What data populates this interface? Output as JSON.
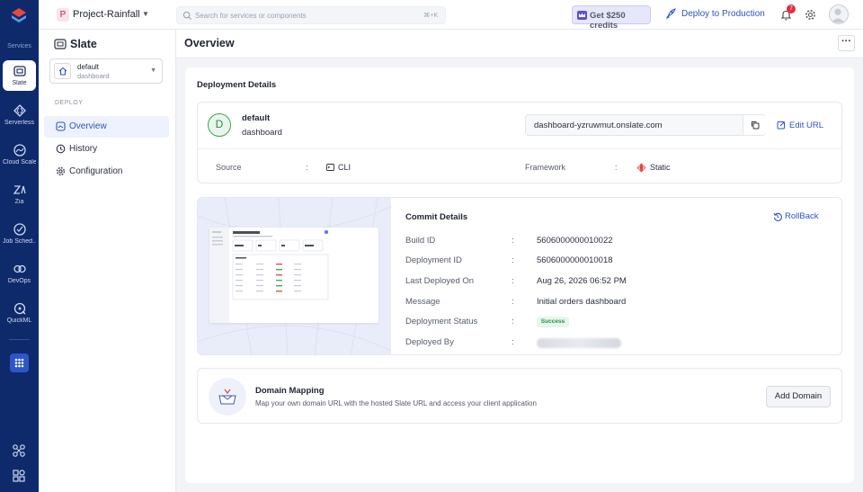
{
  "rail": {
    "section": "Services",
    "items": [
      {
        "label": "Slate",
        "icon": "slate-icon"
      },
      {
        "label": "Serverless",
        "icon": "serverless-icon"
      },
      {
        "label": "Cloud Scale",
        "icon": "cloud-scale-icon"
      },
      {
        "label": "Zia",
        "icon": "zia-icon"
      },
      {
        "label": "Job Sched...",
        "icon": "job-scheduling-icon"
      },
      {
        "label": "DevOps",
        "icon": "devops-icon"
      },
      {
        "label": "QuickML",
        "icon": "quickml-icon"
      }
    ]
  },
  "topbar": {
    "project_initial": "P",
    "project_name": "Project-Rainfall",
    "search_placeholder": "Search for services or components",
    "search_shortcut": "⌘+K",
    "credits_label": "Get $250 credits",
    "deploy_label": "Deploy to Production",
    "notifications_count": "7"
  },
  "sidepanel": {
    "title": "Slate",
    "select_line1": "default",
    "select_line2": "dashboard",
    "section": "DEPLOY",
    "items": [
      {
        "label": "Overview",
        "active": true
      },
      {
        "label": "History",
        "active": false
      },
      {
        "label": "Configuration",
        "active": false
      }
    ]
  },
  "main": {
    "title": "Overview",
    "more_label": "···",
    "deployment_details_title": "Deployment Details",
    "deployment": {
      "initial": "D",
      "name": "default",
      "sub": "dashboard",
      "url": "dashboard-yzruwmut.onslate.com",
      "edit_url_label": "Edit URL",
      "source_label": "Source",
      "source_value": "CLI",
      "framework_label": "Framework",
      "framework_value": "Static",
      "colon": ":"
    },
    "commit": {
      "title": "Commit Details",
      "rollback_label": "RollBack",
      "rows": [
        {
          "label": "Build ID",
          "value": "5606000000010022"
        },
        {
          "label": "Deployment ID",
          "value": "5606000000010018"
        },
        {
          "label": "Last Deployed On",
          "value": "Aug 26, 2026 06:52 PM"
        },
        {
          "label": "Message",
          "value": "Initial orders dashboard"
        },
        {
          "label": "Deployment Status",
          "value": "Success"
        },
        {
          "label": "Deployed By",
          "value": ""
        }
      ]
    },
    "domain": {
      "title": "Domain Mapping",
      "description": "Map your own domain URL with the hosted Slate URL and access your client application",
      "button_label": "Add Domain"
    }
  },
  "colors": {
    "rail_bg": "#0e2a6b",
    "accent": "#2c54c4",
    "success": "#21913f",
    "badge_red": "#e0303f"
  }
}
